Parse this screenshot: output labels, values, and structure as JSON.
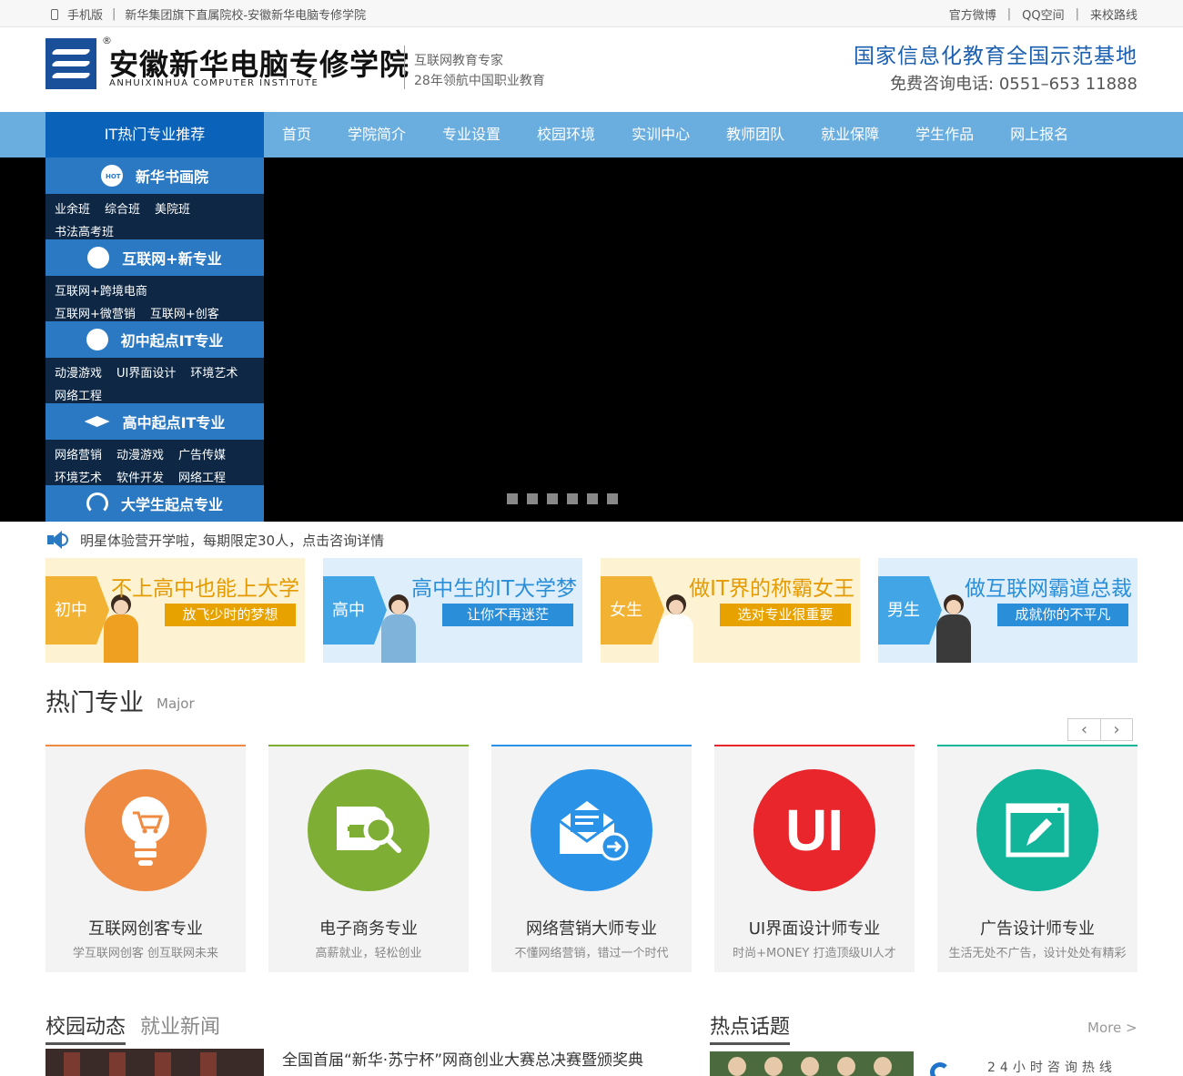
{
  "topbar": {
    "mobile_label": "手机版",
    "school_desc": "新华集团旗下直属院校-安徽新华电脑专修学院",
    "links": [
      "官方微博",
      "QQ空间",
      "来校路线"
    ]
  },
  "header": {
    "logo_cn": "安徽新华电脑专修学院",
    "logo_en": "ANHUIXINHUA COMPUTER INSTITUTE",
    "registered": "®",
    "slogan_1": "互联网教育专家",
    "slogan_2": "28年领航中国职业教育",
    "base_title": "国家信息化教育全国示范基地",
    "hotline": "免费咨询电话: 0551–653  11888"
  },
  "nav": {
    "category_label": "IT热门专业推荐",
    "items": [
      "首页",
      "学院简介",
      "专业设置",
      "校园环境",
      "实训中心",
      "教师团队",
      "就业保障",
      "学生作品",
      "网上报名"
    ]
  },
  "side_menu": [
    {
      "title": "新华书画院",
      "rows": [
        [
          "业余班",
          "综合班",
          "美院班"
        ],
        [
          "书法高考班"
        ]
      ]
    },
    {
      "title": "互联网+新专业",
      "rows": [
        [
          "互联网+跨境电商"
        ],
        [
          "互联网+微营销",
          "互联网+创客"
        ]
      ]
    },
    {
      "title": "初中起点IT专业",
      "rows": [
        [
          "动漫游戏",
          "UI界面设计",
          "环境艺术"
        ],
        [
          "网络工程"
        ]
      ]
    },
    {
      "title": "高中起点IT专业",
      "rows": [
        [
          "网络营销",
          "动漫游戏",
          "广告传媒"
        ],
        [
          "环境艺术",
          "软件开发",
          "网络工程"
        ]
      ]
    },
    {
      "title": "大学生起点专业",
      "rows": []
    }
  ],
  "notice": {
    "text": "明星体验营开学啦，每期限定30人，点击咨询详情"
  },
  "promos": [
    {
      "tag": "初中",
      "head": "不上高中也能上大学",
      "sub": "放飞少时的梦想",
      "tag_color": "#f2b233",
      "bg": "#fdf3d2",
      "head_color": "#e49a00",
      "sub_bg": "#e8a200",
      "body_color": "#f0a020"
    },
    {
      "tag": "高中",
      "head": "高中生的IT大学梦",
      "sub": "让你不再迷茫",
      "tag_color": "#42a6e6",
      "bg": "#deeefb",
      "head_color": "#2a8fd8",
      "sub_bg": "#2a8fd8",
      "body_color": "#7fb3d9"
    },
    {
      "tag": "女生",
      "head": "做IT界的称霸女王",
      "sub": "选对专业很重要",
      "tag_color": "#f2b233",
      "bg": "#fdf3d2",
      "head_color": "#e49a00",
      "sub_bg": "#e8a200",
      "body_color": "#ffffff"
    },
    {
      "tag": "男生",
      "head": "做互联网霸道总裁",
      "sub": "成就你的不平凡",
      "tag_color": "#42a6e6",
      "bg": "#deeefb",
      "head_color": "#2a8fd8",
      "sub_bg": "#2a8fd8",
      "body_color": "#3a3a3a"
    }
  ],
  "majors_section": {
    "title": "热门专业",
    "title_en": "Major",
    "prev_icon": "‹",
    "next_icon": "›",
    "items": [
      {
        "name": "互联网创客专业",
        "desc": "学互联网创客 创互联网未来",
        "color": "#ef8a42",
        "icon": "bulb-cart-icon"
      },
      {
        "name": "电子商务专业",
        "desc": "高薪就业，轻松创业",
        "color": "#7fae34",
        "icon": "eo-search-icon"
      },
      {
        "name": "网络营销大师专业",
        "desc": "不懂网络营销，错过一个时代",
        "color": "#2a93e8",
        "icon": "mail-arrow-icon"
      },
      {
        "name": "UI界面设计师专业",
        "desc": "时尚+MONEY 打造顶级UI人才",
        "color": "#e8262b",
        "icon": "ui-text-icon",
        "icon_text": "UI"
      },
      {
        "name": "广告设计师专业",
        "desc": "生活无处不广告，设计处处有精彩",
        "color": "#12b59a",
        "icon": "pencil-board-icon"
      }
    ]
  },
  "news": {
    "tab_active": "校园动态",
    "tab_inactive": "就业新闻",
    "headline": "全国首届“新华·苏宁杯”网商创业大赛总决赛暨颁奖典",
    "hot_title": "热点话题",
    "more": "More >",
    "hotline_label": "24小时咨询热线"
  }
}
